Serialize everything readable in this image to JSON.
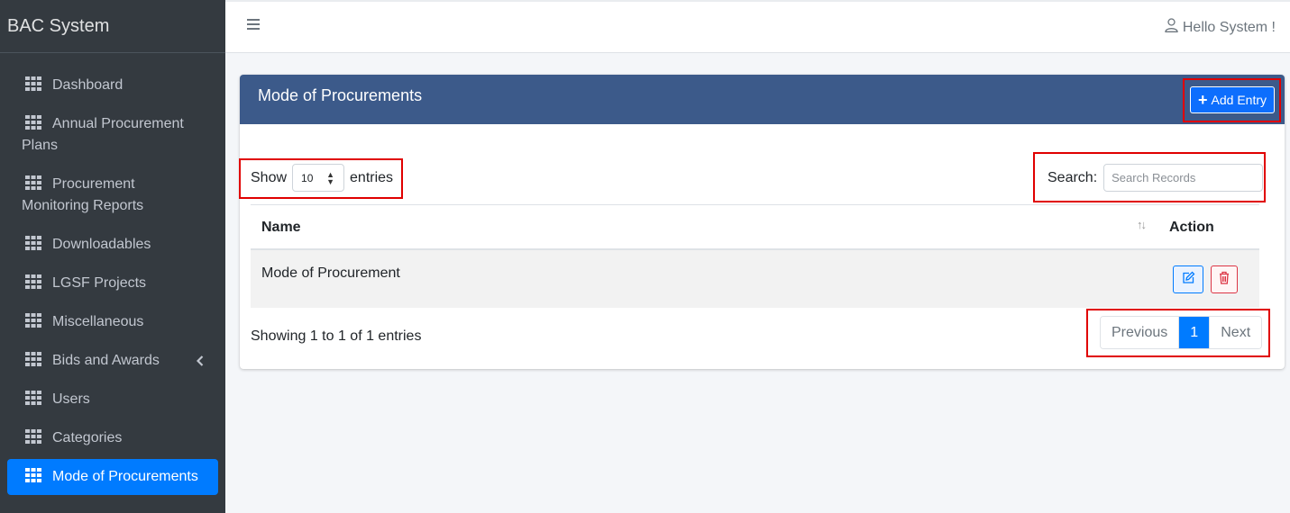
{
  "brand": {
    "name": "BAC System"
  },
  "sidebar": {
    "items": [
      {
        "label": "Dashboard"
      },
      {
        "label": "Annual Procurement",
        "label2": "Plans"
      },
      {
        "label": "Procurement",
        "label2": "Monitoring Reports"
      },
      {
        "label": "Downloadables"
      },
      {
        "label": "LGSF Projects"
      },
      {
        "label": "Miscellaneous"
      },
      {
        "label": "Bids and Awards"
      },
      {
        "label": "Users"
      },
      {
        "label": "Categories"
      },
      {
        "label": "Mode of Procurements"
      }
    ]
  },
  "topbar": {
    "greeting": "Hello System !"
  },
  "card": {
    "title": "Mode of Procurements",
    "add_label": "Add Entry"
  },
  "table_controls": {
    "show_label": "Show",
    "page_size": "10",
    "entries_label": "entries",
    "search_label": "Search:",
    "search_placeholder": "Search Records"
  },
  "table": {
    "columns": [
      "Name",
      "Action"
    ],
    "rows": [
      {
        "name": "Mode of Procurement"
      }
    ]
  },
  "footer": {
    "info": "Showing 1 to 1 of 1 entries",
    "prev": "Previous",
    "page": "1",
    "next": "Next"
  },
  "colors": {
    "sidebar_bg": "#343a40",
    "accent": "#007bff",
    "card_header": "#3c5a8a",
    "highlight_box": "#e00000"
  }
}
